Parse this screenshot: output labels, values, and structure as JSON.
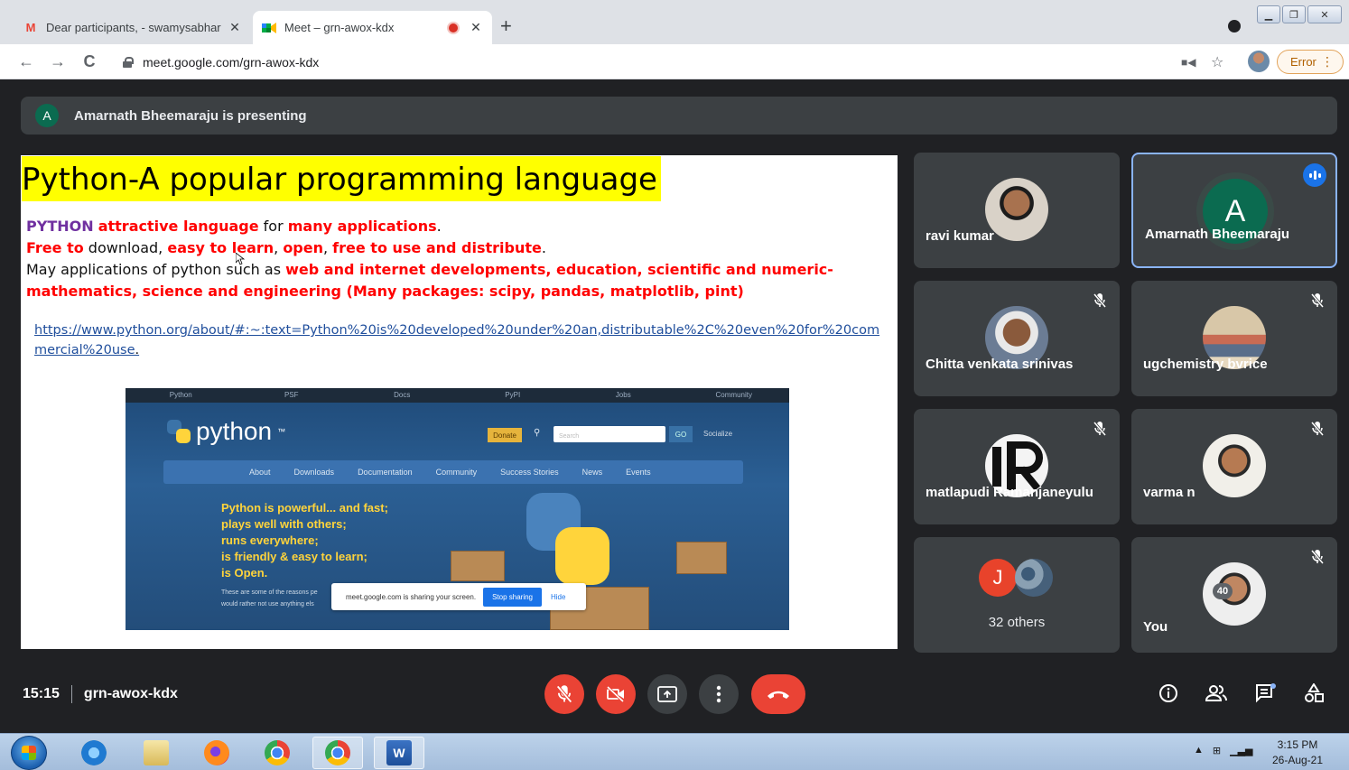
{
  "browser": {
    "tabs": [
      {
        "title": "Dear participants, - swamysabhar",
        "favicon": "gmail-icon"
      },
      {
        "title": "Meet – grn-awox-kdx",
        "favicon": "meet-icon",
        "recording": true
      }
    ],
    "new_tab": "+",
    "url": "meet.google.com/grn-awox-kdx",
    "error_label": "Error",
    "window_controls": [
      "minimize",
      "restore",
      "close"
    ]
  },
  "meet": {
    "presenter_initial": "A",
    "presenting_text": "Amarnath Bheemaraju is presenting",
    "slide": {
      "title": "Python-A popular programming language",
      "line1_a": "PYTHON",
      "line1_b": "attractive language",
      "line1_c": " for ",
      "line1_d": "many applications",
      "line1_e": ".",
      "line2_a": "Free to",
      "line2_b": " download, ",
      "line2_c": "easy to learn",
      "line2_d": ", ",
      "line2_e": "open",
      "line2_f": ", ",
      "line2_g": "free to use and distribute",
      "line2_h": ".",
      "line3_a": "May applications of python such as ",
      "line3_b": "web and internet developments, education, scientific and numeric-mathematics, science and engineering (Many packages: scipy, pandas, matplotlib, pint)",
      "link": "https://www.python.org/about/#:~:text=Python%20is%20developed%20under%20an,distributable%2C%20even%20for%20commercial%20use",
      "link_suffix": ".",
      "pyshot": {
        "topnav": [
          "Python",
          "PSF",
          "Docs",
          "PyPI",
          "Jobs",
          "Community"
        ],
        "logo_text": "python",
        "logo_tm": "™",
        "donate": "Donate",
        "search_placeholder": "Search",
        "go": "GO",
        "socialize": "Socialize",
        "mainnav": [
          "About",
          "Downloads",
          "Documentation",
          "Community",
          "Success Stories",
          "News",
          "Events"
        ],
        "tagline": [
          "Python is powerful... and fast;",
          "plays well with others;",
          "runs everywhere;",
          "is friendly & easy to learn;",
          "is Open."
        ],
        "smalltext": [
          "These are some of the reasons pe",
          "would rather not use anything els"
        ],
        "sharebar_text": "meet.google.com is sharing your screen.",
        "stop_sharing": "Stop sharing",
        "hide": "Hide"
      }
    },
    "participants": [
      {
        "name": "ravi kumar",
        "muted": false
      },
      {
        "name": "Amarnath Bheemaraju",
        "initial": "A",
        "speaking": true
      },
      {
        "name": "Chitta venkata srinivas",
        "muted": true
      },
      {
        "name": "ugchemistry bvrice",
        "muted": true
      },
      {
        "name": "matlapudi Ramanjaneyulu",
        "muted": true
      },
      {
        "name": "varma n",
        "muted": true
      },
      {
        "name": "32 others",
        "initial": "J"
      },
      {
        "name": "You",
        "muted": true
      }
    ],
    "bottom": {
      "time": "15:15",
      "meeting_code": "grn-awox-kdx",
      "participant_count": "40"
    }
  },
  "taskbar": {
    "apps": [
      "ie-icon",
      "file-explorer-icon",
      "firefox-icon",
      "chrome-icon",
      "chrome-profile-icon",
      "word-icon"
    ],
    "time": "3:15 PM",
    "date": "26-Aug-21"
  },
  "colors": {
    "meet_bg": "#202124",
    "tile_bg": "#3c4043",
    "red": "#ea4335",
    "accent_blue": "#1a73e8",
    "slide_title_highlight": "#ffff00",
    "slide_red": "#ff0000",
    "slide_purple": "#7030a0"
  }
}
